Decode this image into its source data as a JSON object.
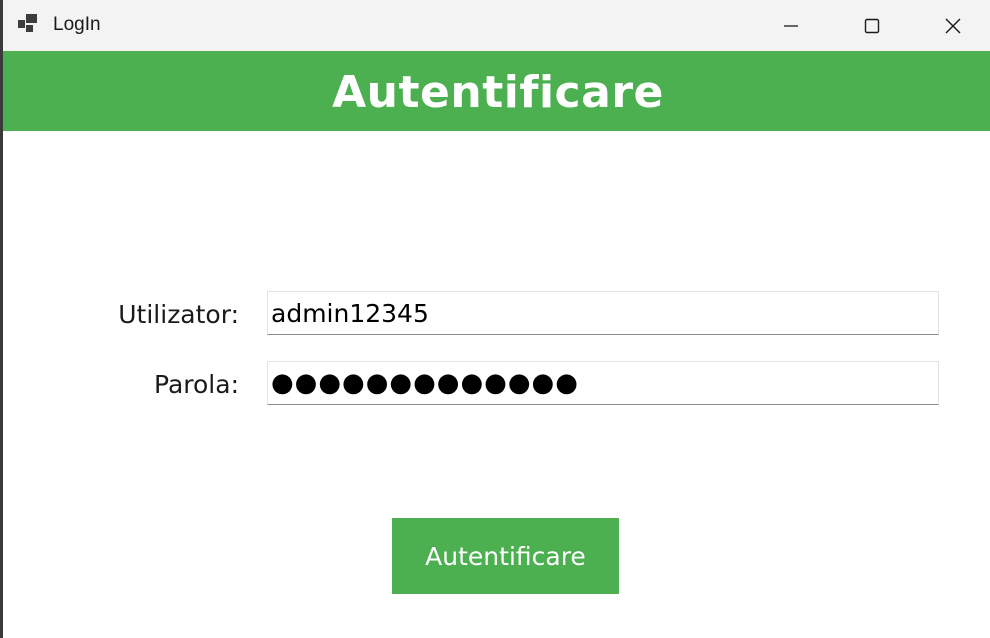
{
  "window": {
    "title": "LogIn",
    "controls": {
      "minimize": "minimize-icon",
      "maximize": "maximize-icon",
      "close": "close-icon"
    }
  },
  "header": {
    "title": "Autentificare",
    "background_color": "#4caf50",
    "text_color": "#ffffff"
  },
  "form": {
    "username_label": "Utilizator:",
    "username_value": "admin12345",
    "password_label": "Parola:",
    "password_value": "●●●●●●●●●●●●●",
    "submit_label": "Autentificare",
    "submit_color": "#4caf50"
  }
}
